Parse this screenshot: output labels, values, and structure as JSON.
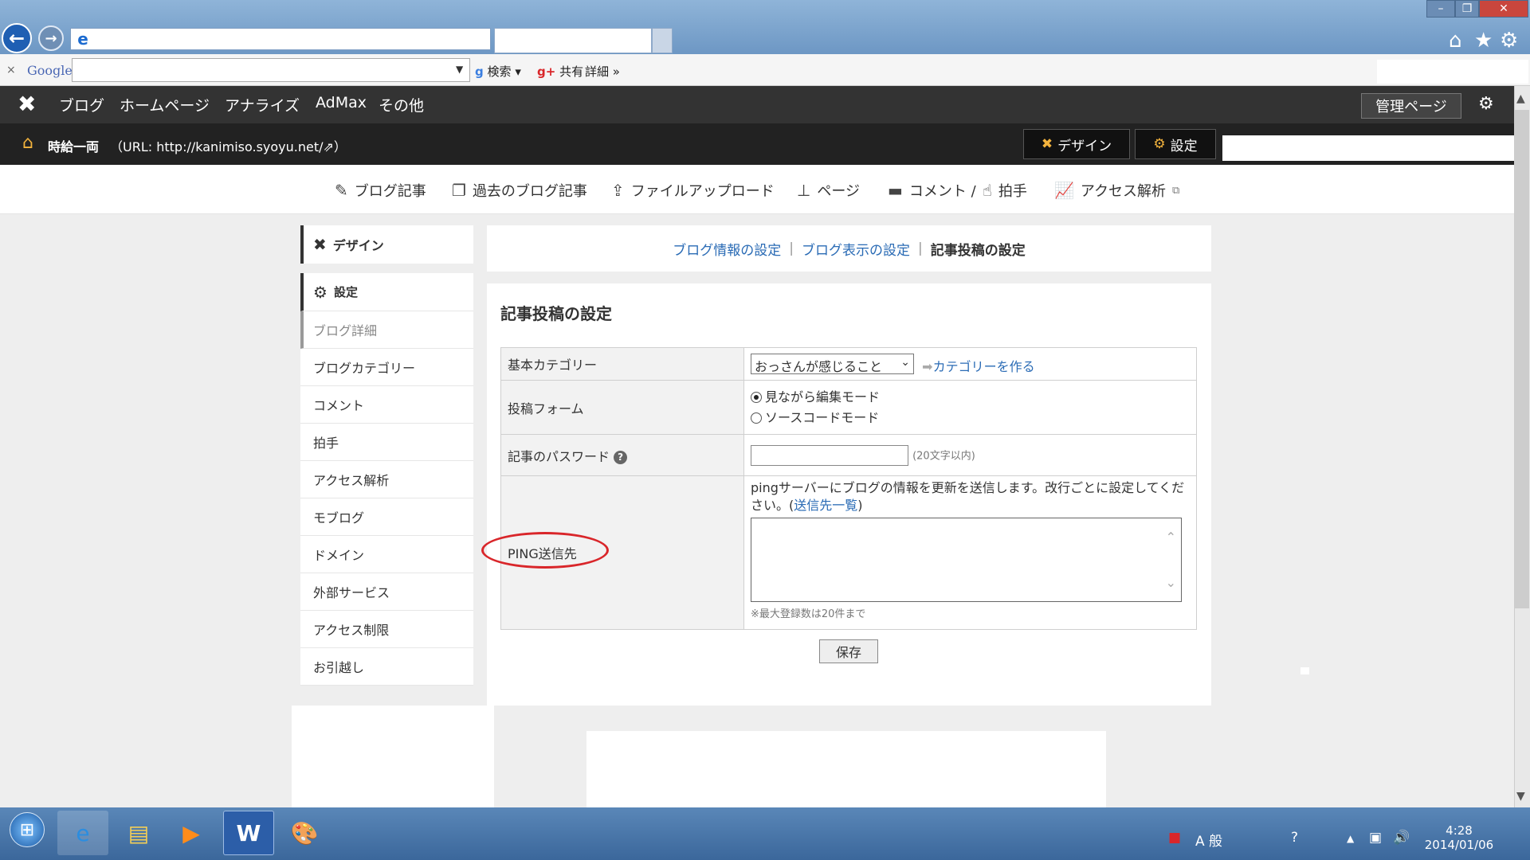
{
  "browser": {
    "address_value": "",
    "tab_value": "",
    "window_buttons": {
      "minimize": "–",
      "maximize": "❐",
      "close": "✕"
    },
    "google_bar": {
      "close": "×",
      "logo": "Google",
      "search_value": "",
      "search_button": "検索",
      "share": "共有",
      "details": "詳細 »"
    }
  },
  "blog_header": {
    "nav": [
      "ブログ",
      "ホームページ",
      "アナライズ",
      "AdMax",
      "その他"
    ],
    "admin_button": "管理ページ",
    "site_title": "時給一両",
    "site_url": "（URL: http://kanimiso.syoyu.net/",
    "site_url_close": "）",
    "design_button": "デザイン",
    "setting_button": "設定"
  },
  "menu": [
    {
      "icon": "edit-icon",
      "label": "ブログ記事"
    },
    {
      "icon": "pages-icon",
      "label": "過去のブログ記事"
    },
    {
      "icon": "upload-icon",
      "label": "ファイルアップロード"
    },
    {
      "icon": "sitemap-icon",
      "label": "ページ"
    },
    {
      "icon": "comment-icon",
      "label": "コメント / "
    },
    {
      "icon": "clap-icon",
      "label": "拍手"
    },
    {
      "icon": "chart-icon",
      "label": "アクセス解析"
    }
  ],
  "sidebar": {
    "design": "デザイン",
    "setting": "設定",
    "items": [
      "ブログ詳細",
      "ブログカテゴリー",
      "コメント",
      "拍手",
      "アクセス解析",
      "モブログ",
      "ドメイン",
      "外部サービス",
      "アクセス制限",
      "お引越し"
    ]
  },
  "tabs": {
    "info": "ブログ情報の設定",
    "sep": "|",
    "display": "ブログ表示の設定",
    "post": "記事投稿の設定"
  },
  "form": {
    "heading": "記事投稿の設定",
    "category_label": "基本カテゴリー",
    "category_value": "おっさんが感じること",
    "category_link": "カテゴリーを作る",
    "post_form_label": "投稿フォーム",
    "radio_1": "見ながら編集モード",
    "radio_2": "ソースコードモード",
    "radio_selected": 1,
    "password_label": "記事のパスワード",
    "password_value": "",
    "password_hint": "(20文字以内)",
    "ping_label": "PING送信先",
    "ping_desc": "pingサーバーにブログの情報を更新を送信します。改行ごとに設定してください。(",
    "ping_link": "送信先一覧",
    "ping_desc_end": ")",
    "ping_value": "",
    "ping_note": "※最大登録数は20件まで",
    "save_button": "保存"
  },
  "taskbar": {
    "ime": "A 般",
    "time": "4:28",
    "date": "2014/01/06"
  },
  "colors": {
    "link": "#2a6bb5",
    "header_dark": "#333333",
    "accent_orange": "#f3b33d",
    "highlight_red": "#d9262a"
  }
}
